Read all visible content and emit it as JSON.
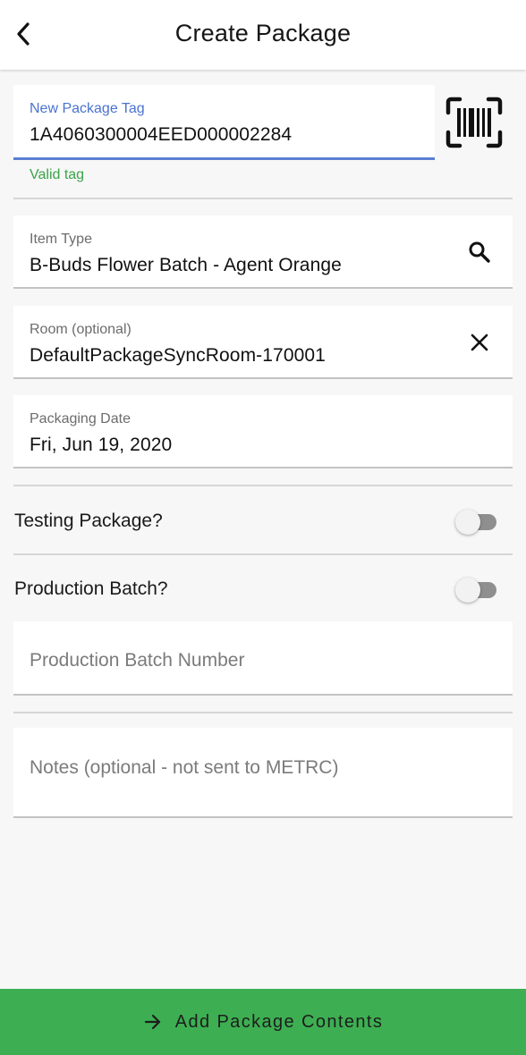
{
  "appbar": {
    "title": "Create Package",
    "back_icon": "chevron-left-icon"
  },
  "new_package_tag": {
    "label": "New Package Tag",
    "value": "1A4060300004EED000002284",
    "helper": "Valid tag",
    "helper_color": "#3aa34a",
    "accent_color": "#4a72cf",
    "scan_icon": "barcode-scan-icon"
  },
  "item_type": {
    "label": "Item Type",
    "value": "B-Buds Flower Batch - Agent Orange",
    "icon": "search-icon"
  },
  "room": {
    "label": "Room (optional)",
    "value": "DefaultPackageSyncRoom-170001",
    "icon": "close-icon"
  },
  "packaging_date": {
    "label": "Packaging Date",
    "value": "Fri, Jun 19, 2020"
  },
  "testing_package": {
    "label": "Testing Package?",
    "checked": false
  },
  "production_batch": {
    "label": "Production Batch?",
    "checked": false
  },
  "production_batch_number": {
    "placeholder": "Production Batch Number",
    "value": ""
  },
  "notes": {
    "placeholder": "Notes (optional - not sent to METRC)",
    "value": ""
  },
  "bottom_button": {
    "label": "Add Package Contents",
    "icon": "arrow-right-icon",
    "color": "#3daf52"
  }
}
